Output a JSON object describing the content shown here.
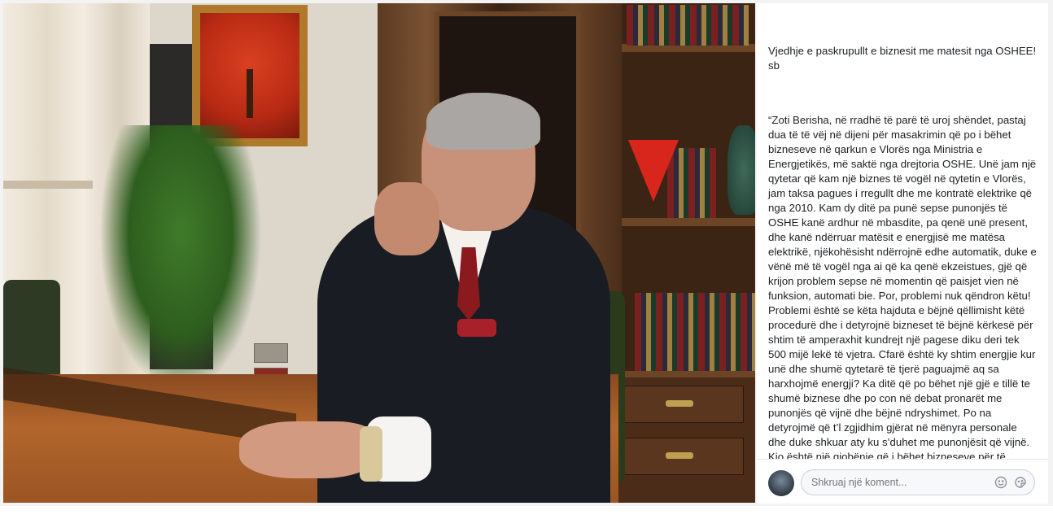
{
  "post": {
    "title_line": "Vjedhje e paskrupullt e biznesit me matesit nga OSHEE! sb",
    "quote": "“Zoti Berisha, në rradhë të parë të uroj shëndet, pastaj dua të të vëj në dijeni për masakrimin që po i bëhet bizneseve në qarkun e Vlorës nga Ministria e Energjetikës, më saktë nga drejtoria OSHE. Unë jam një qytetar që kam një biznes të vogël në qytetin e Vlorës, jam taksa pagues i rregullt dhe me kontratë elektrike që nga 2010. Kam dy ditë pa punë sepse punonjës të OSHE kanë ardhur në mbasdite, pa qenë unë present, dhe kanë ndërruar matësit e energjisë me matësa elektrikë, njëkohësisht ndërrojnë edhe automatik, duke e vënë më të vogël nga ai që ka qenë ekzeistues, gjë që krijon problem sepse në momentin që paisjet vien në funksion, automati bie. Por, problemi nuk qëndron këtu! Problemi është se këta hajduta e bëjnë qëllimisht këtë procedurë dhe i detyrojnë bizneset të bëjnë kërkesë për shtim të amperaxhit kundrejt një pagese diku deri tek 500 mijë lekë të vjetra. Cfarë është ky shtim energjie kur unë dhe shumë qytetarë të tjerë paguajmë aq sa harxhojmë energji? Ka ditë që po bëhet një gjë e tillë te shumë biznese dhe po con në debat pronarët me punonjës që vijnë dhe bëjnë ndryshimet. Po na detyrojmë që t’l zgjidhim gjërat në mënyra personale dhe duke shkuar aty ku s’duhet me punonjësit që vijnë. Kjo është një gjobënie që i bëhet bizneseve për të mbushur arkën e drogës.”"
  },
  "comment": {
    "placeholder": "Shkruaj një koment...",
    "emoji_icon": "emoji-icon",
    "sticker_icon": "sticker-icon"
  },
  "photo": {
    "icon": "photo-image"
  },
  "colors": {
    "panel_bg": "#ffffff",
    "text": "#1c1e21",
    "muted": "#90949c",
    "border": "#ccd0d5"
  }
}
